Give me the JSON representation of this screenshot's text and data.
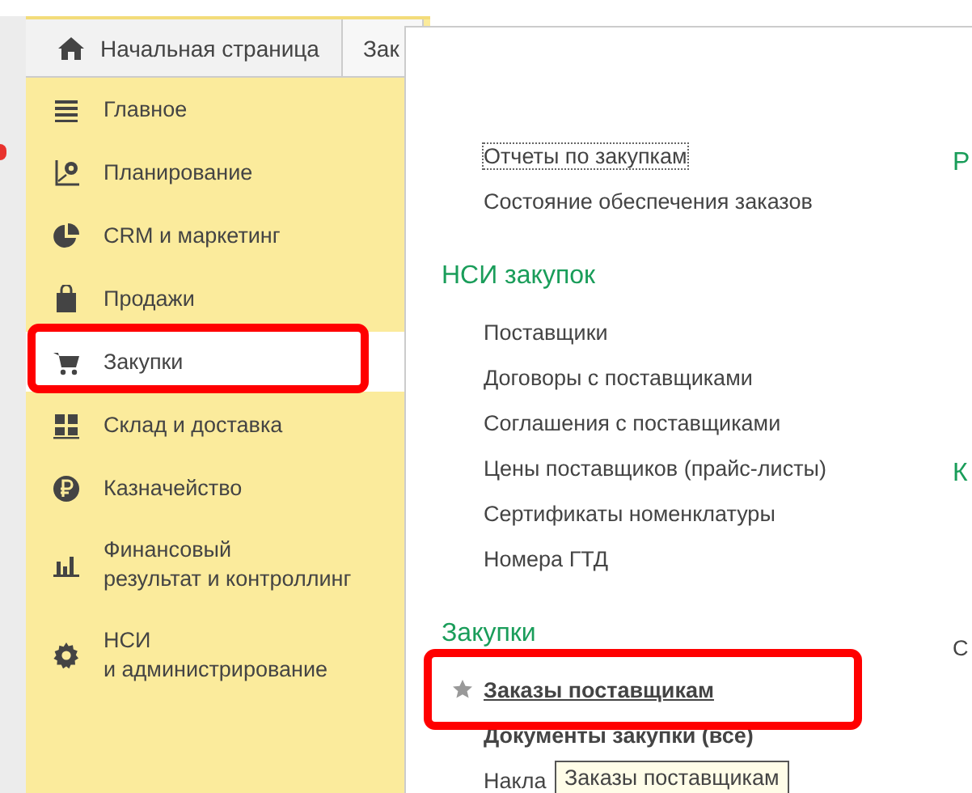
{
  "tabs": [
    {
      "label": "Начальная страница",
      "selected": true
    },
    {
      "label": "Зак",
      "selected": false
    }
  ],
  "sidebar": {
    "items": [
      {
        "label": "Главное",
        "selected": false
      },
      {
        "label": "Планирование",
        "selected": false
      },
      {
        "label": "CRM и маркетинг",
        "selected": false
      },
      {
        "label": "Продажи",
        "selected": false
      },
      {
        "label": "Закупки",
        "selected": true
      },
      {
        "label": "Склад и доставка",
        "selected": false
      },
      {
        "label": "Казначейство",
        "selected": false
      },
      {
        "label": "Финансовый\nрезультат и контроллинг",
        "selected": false
      },
      {
        "label": "НСИ\nи администрирование",
        "selected": false
      }
    ]
  },
  "panel": {
    "sections": [
      {
        "items": [
          {
            "label": "Отчеты по закупкам",
            "focused": true,
            "starred": false,
            "bold": false,
            "hovered": false
          },
          {
            "label": "Состояние обеспечения заказов",
            "focused": false,
            "starred": false,
            "bold": false,
            "hovered": false
          }
        ]
      },
      {
        "title": "НСИ закупок",
        "items": [
          {
            "label": "Поставщики",
            "focused": false,
            "starred": false,
            "bold": false,
            "hovered": false
          },
          {
            "label": "Договоры с поставщиками",
            "focused": false,
            "starred": false,
            "bold": false,
            "hovered": false
          },
          {
            "label": "Соглашения с поставщиками",
            "focused": false,
            "starred": false,
            "bold": false,
            "hovered": false
          },
          {
            "label": "Цены поставщиков (прайс-листы)",
            "focused": false,
            "starred": false,
            "bold": false,
            "hovered": false
          },
          {
            "label": "Сертификаты номенклатуры",
            "focused": false,
            "starred": false,
            "bold": false,
            "hovered": false
          },
          {
            "label": "Номера ГТД",
            "focused": false,
            "starred": false,
            "bold": false,
            "hovered": false
          }
        ]
      },
      {
        "title": "Закупки",
        "items": [
          {
            "label": "Заказы поставщикам",
            "focused": false,
            "starred": true,
            "bold": true,
            "hovered": true
          },
          {
            "label": "Документы закупки (все)",
            "focused": false,
            "starred": false,
            "bold": true,
            "hovered": false
          },
          {
            "label": "Накла",
            "focused": false,
            "starred": false,
            "bold": false,
            "hovered": false
          }
        ]
      }
    ],
    "column_2": [
      {
        "label": "Р",
        "kind": "heading"
      },
      {
        "label": "К",
        "kind": "heading"
      },
      {
        "label": "С",
        "kind": "link"
      }
    ]
  },
  "tooltip": "Заказы поставщикам"
}
